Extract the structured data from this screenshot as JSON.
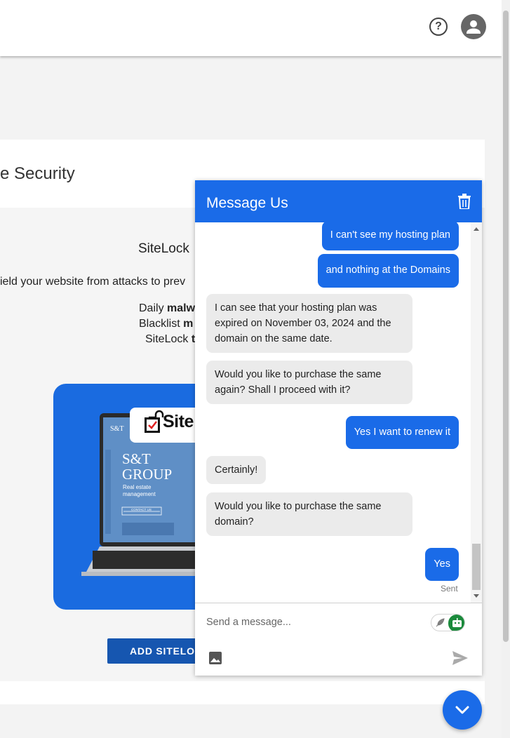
{
  "topbar": {
    "help_icon": "question-circle",
    "help_glyph": "?",
    "avatar_icon": "person"
  },
  "page": {
    "card_title": "e Security",
    "product_title": "SiteLock",
    "description": "ield your website from attacks to prev",
    "features": [
      {
        "prefix": "Daily ",
        "bold": "malw"
      },
      {
        "prefix": "Blacklist ",
        "bold": "m"
      },
      {
        "prefix": "SiteLock ",
        "bold": "t"
      }
    ],
    "hero": {
      "brand": "Site",
      "logo_small": "S&T",
      "company": "S&T GROUP",
      "tagline": "Real estate management",
      "cta": "CONTACT US"
    },
    "add_button_label": "ADD SITELOC"
  },
  "chat": {
    "title": "Message Us",
    "messages": [
      {
        "from": "user",
        "text": "I can't see my hosting plan"
      },
      {
        "from": "user",
        "text": "and nothing at the Domains"
      },
      {
        "from": "agent",
        "text": "I can see that your hosting plan was expired on November 03, 2024 and the domain on the same date."
      },
      {
        "from": "agent",
        "text": "Would you like to purchase the same again? Shall I proceed with it?"
      },
      {
        "from": "user",
        "text": "Yes I want to renew it"
      },
      {
        "from": "agent",
        "text": "Certainly!"
      },
      {
        "from": "agent",
        "text": "Would you like to purchase the same domain?"
      },
      {
        "from": "user",
        "text": "Yes"
      }
    ],
    "status": "Sent",
    "input": {
      "value": "",
      "placeholder": "Send a message..."
    },
    "colors": {
      "accent": "#1a6be8",
      "toggle_on": "#1b8a3c"
    }
  }
}
